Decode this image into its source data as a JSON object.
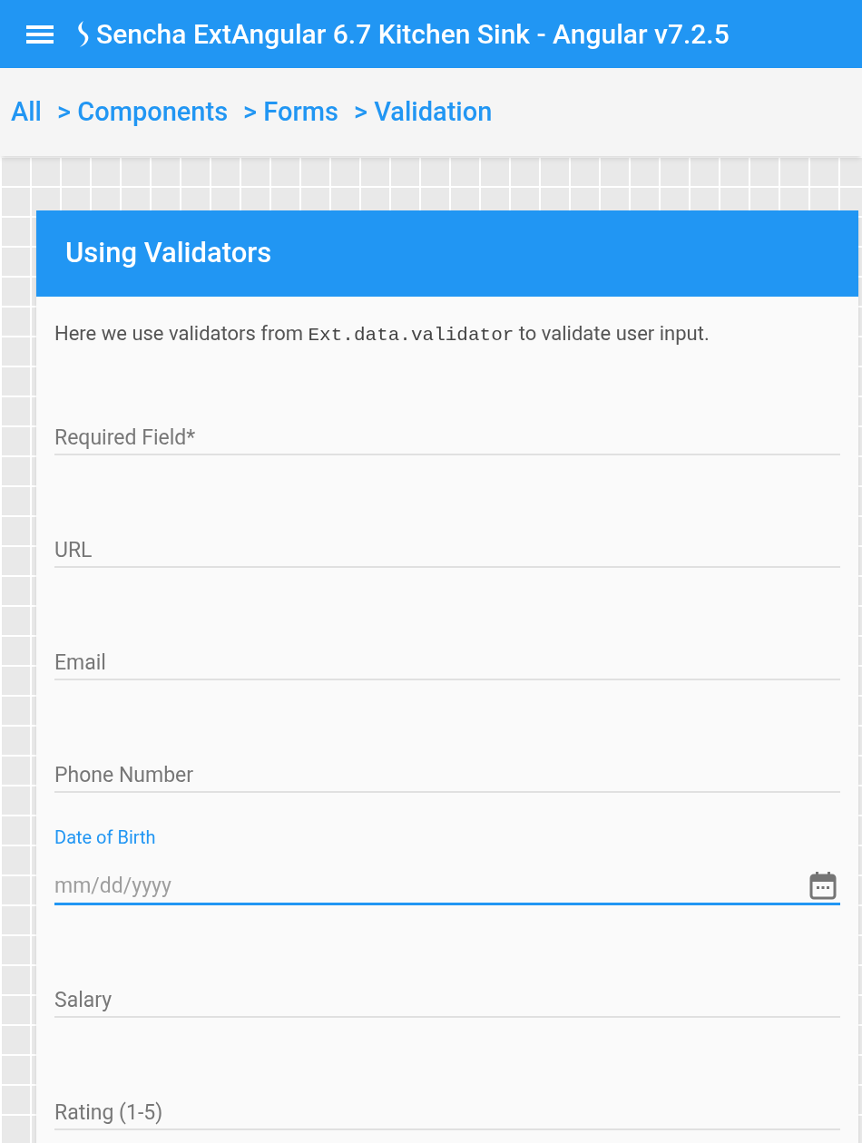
{
  "app_bar": {
    "title": "Sencha ExtAngular 6.7 Kitchen Sink - Angular v7.2.5"
  },
  "breadcrumb": [
    {
      "label": "All"
    },
    {
      "label": "> Components"
    },
    {
      "label": "> Forms"
    },
    {
      "label": "> Validation"
    }
  ],
  "panel": {
    "title": "Using Validators",
    "description": [
      {
        "kind": "text",
        "text": "Here we use validators from "
      },
      {
        "kind": "code",
        "text": "Ext.data.validator"
      },
      {
        "kind": "text",
        "text": " to validate user input."
      }
    ],
    "fields": [
      {
        "kind": "text",
        "label": "Required Field*",
        "focused": false
      },
      {
        "kind": "text",
        "label": "URL",
        "focused": false
      },
      {
        "kind": "text",
        "label": "Email",
        "focused": false
      },
      {
        "kind": "text",
        "label": "Phone Number",
        "focused": false
      },
      {
        "kind": "date",
        "label": "Date of Birth",
        "placeholder": "mm/dd/yyyy",
        "focused": true
      },
      {
        "kind": "text",
        "label": "Salary",
        "focused": false
      },
      {
        "kind": "text",
        "label": "Rating (1-5)",
        "focused": false
      }
    ]
  }
}
